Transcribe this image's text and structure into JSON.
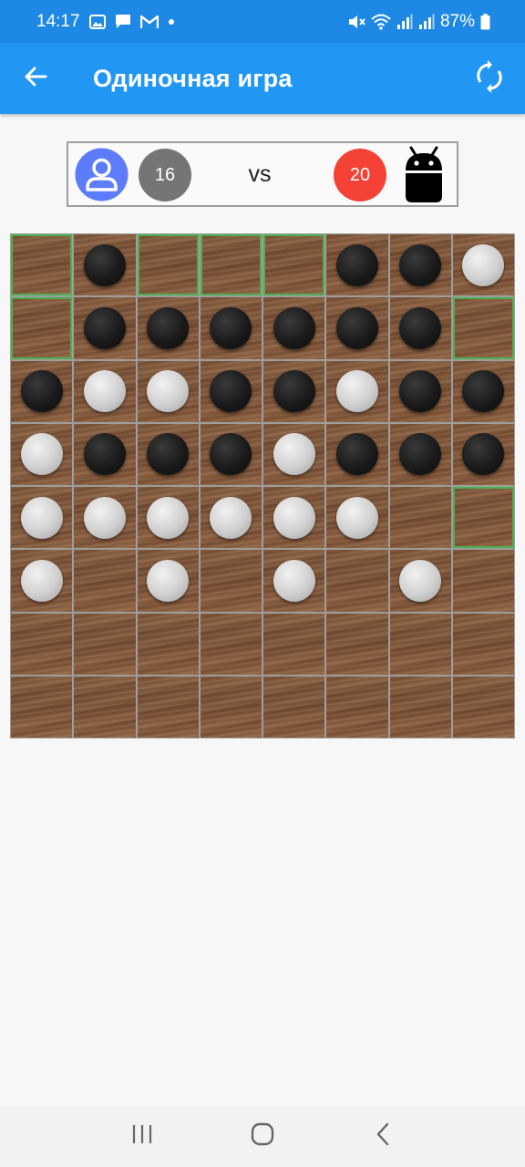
{
  "status_bar": {
    "time": "14:17",
    "battery": "87%",
    "left_icons": [
      "gallery-icon",
      "message-icon",
      "mail-icon",
      "dot-icon"
    ],
    "right_icons": [
      "mute-icon",
      "wifi-icon",
      "signal-icon",
      "signal-icon",
      "battery-icon"
    ]
  },
  "app_bar": {
    "title": "Одиночная игра",
    "back_icon": "arrow-back-icon",
    "refresh_icon": "refresh-icon",
    "color": "#2196f3"
  },
  "score": {
    "human_score": "16",
    "ai_score": "20",
    "vs_label": "vs",
    "human_badge_color": "#757575",
    "ai_badge_color": "#f44336",
    "human_avatar_icon": "person-avatar-icon",
    "ai_avatar_icon": "android-icon"
  },
  "board": {
    "size": 8,
    "legend": "B = black disc, W = white disc, . = empty, h = highlighted possible move",
    "rows": [
      [
        "h",
        "B",
        "h",
        "h",
        "h",
        "B",
        "B",
        "W"
      ],
      [
        "h",
        "B",
        "B",
        "B",
        "B",
        "B",
        "B",
        "h"
      ],
      [
        "B",
        "W",
        "W",
        "B",
        "B",
        "W",
        "B",
        "B"
      ],
      [
        "W",
        "B",
        "B",
        "B",
        "W",
        "B",
        "B",
        "B"
      ],
      [
        "W",
        "W",
        "W",
        "W",
        "W",
        "W",
        ".",
        "h"
      ],
      [
        "W",
        ".",
        "W",
        ".",
        "W",
        ".",
        "W",
        "."
      ],
      [
        ".",
        ".",
        ".",
        ".",
        ".",
        ".",
        ".",
        "."
      ],
      [
        ".",
        ".",
        ".",
        ".",
        ".",
        ".",
        ".",
        "."
      ]
    ],
    "hint_color": "#4caf50"
  },
  "nav_bar": {
    "buttons": [
      "recent-apps-icon",
      "home-icon",
      "back-icon"
    ]
  }
}
